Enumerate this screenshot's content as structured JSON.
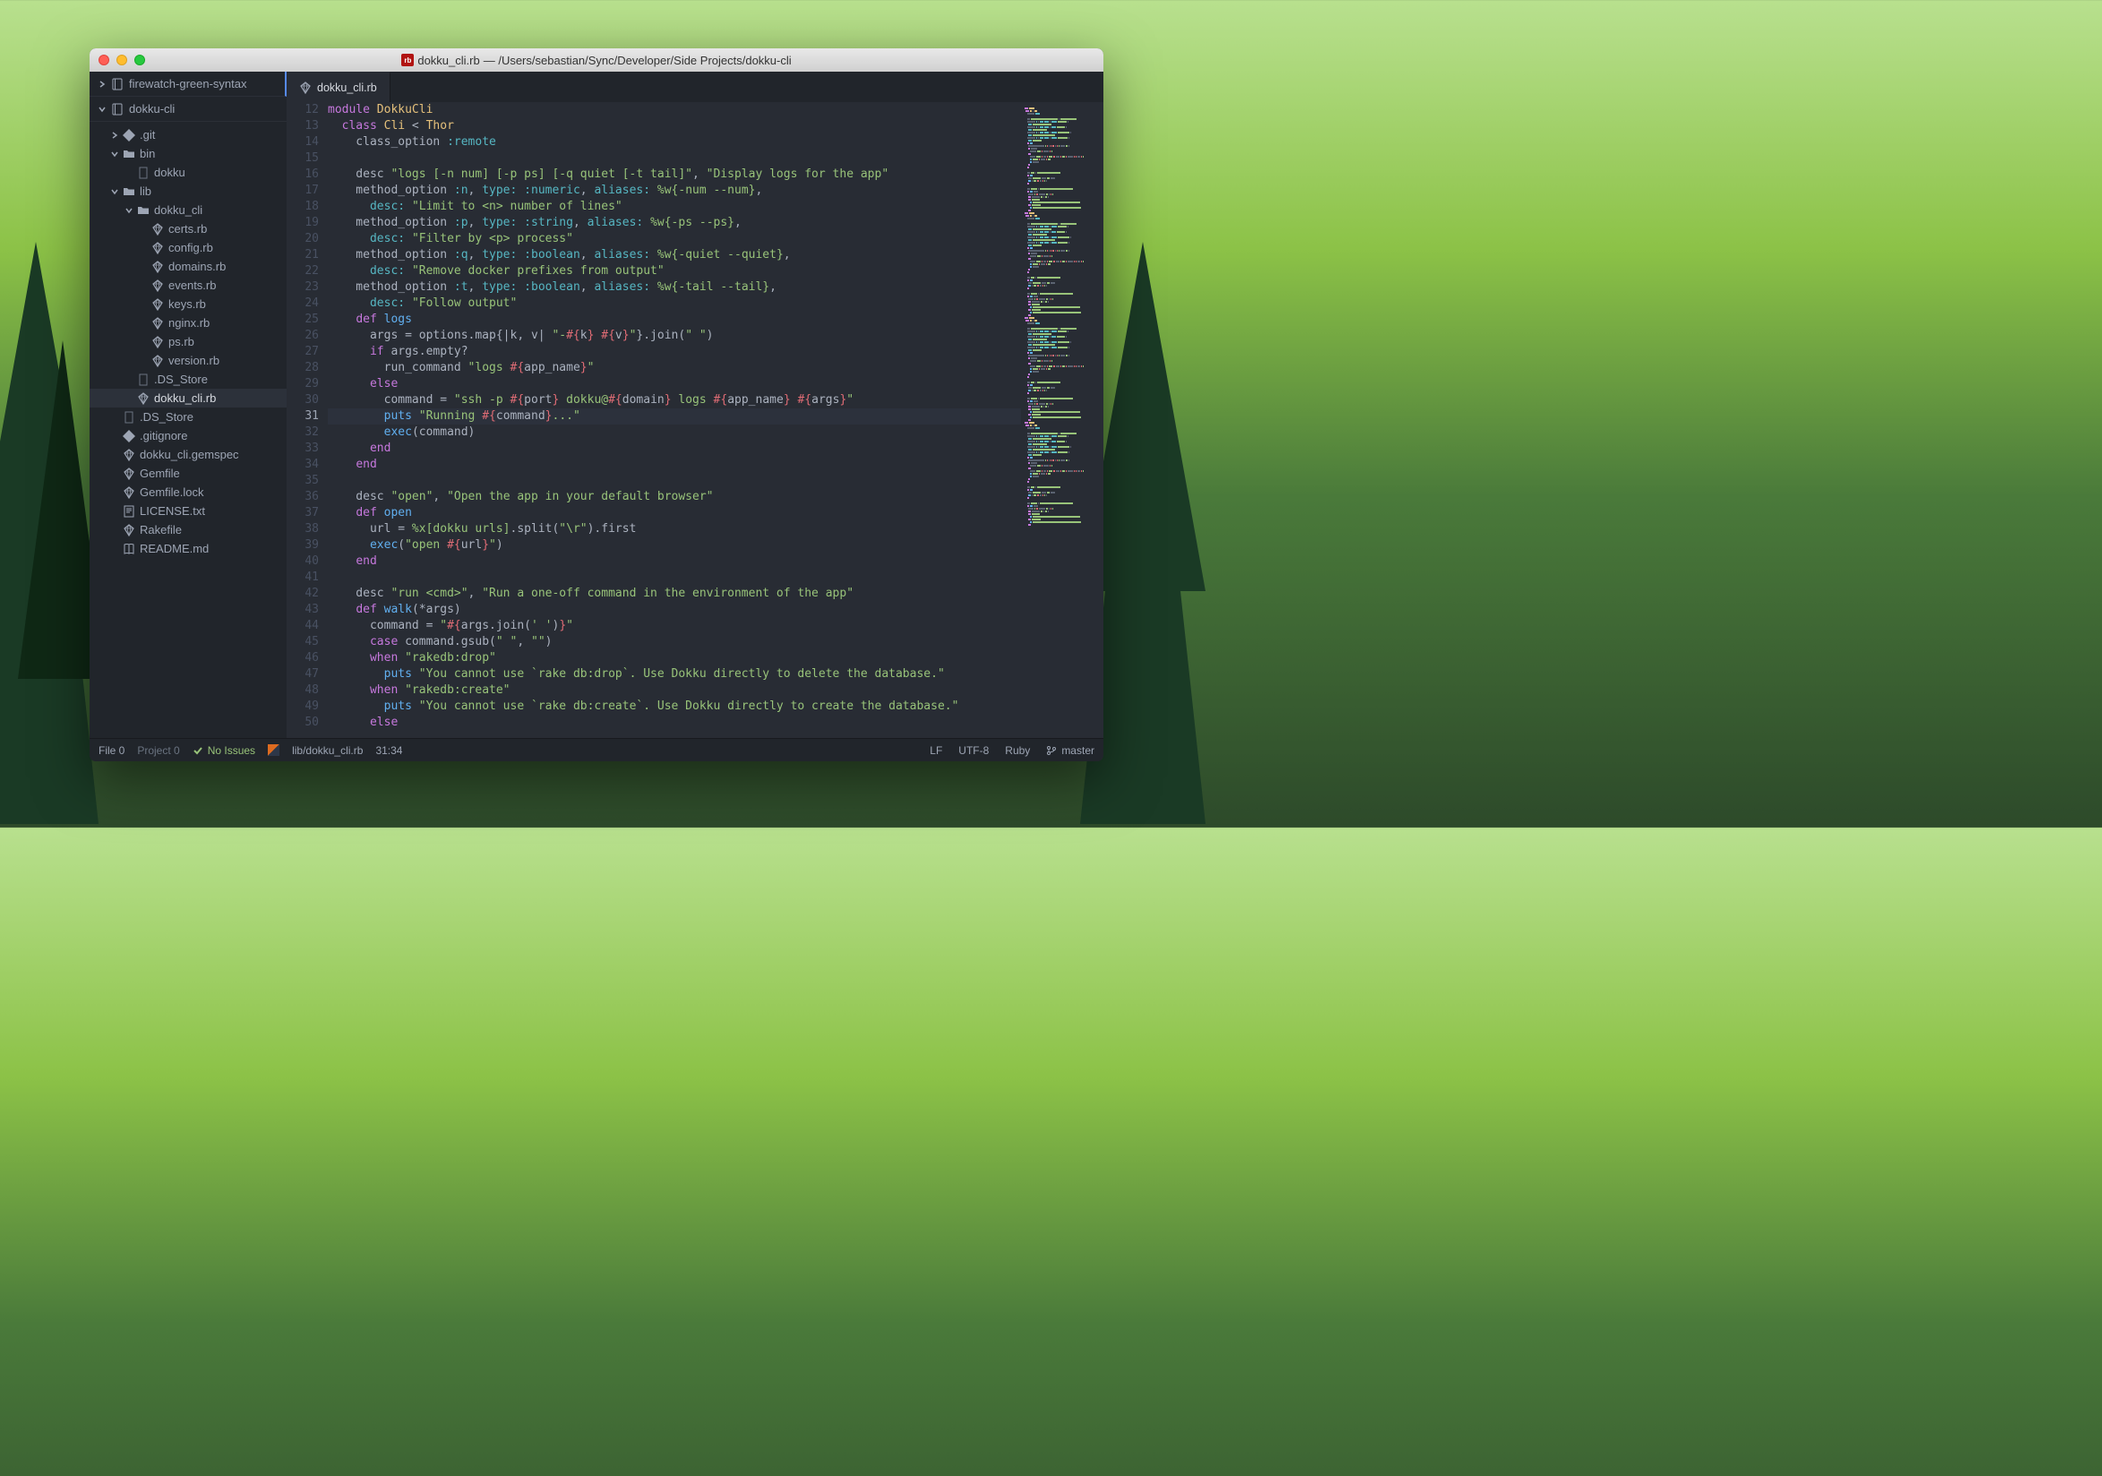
{
  "window": {
    "title_file": "dokku_cli.rb",
    "title_path": "— /Users/sebastian/Sync/Developer/Side Projects/dokku-cli"
  },
  "sidebar": {
    "projects": [
      {
        "name": "firewatch-green-syntax",
        "expanded": false
      },
      {
        "name": "dokku-cli",
        "expanded": true
      }
    ],
    "tree": [
      {
        "level": 1,
        "type": "folder",
        "name": ".git",
        "expanded": false,
        "icon": "git"
      },
      {
        "level": 1,
        "type": "folder",
        "name": "bin",
        "expanded": true,
        "icon": "folder"
      },
      {
        "level": 2,
        "type": "file",
        "name": "dokku",
        "icon": "file"
      },
      {
        "level": 1,
        "type": "folder",
        "name": "lib",
        "expanded": true,
        "icon": "folder"
      },
      {
        "level": 2,
        "type": "folder",
        "name": "dokku_cli",
        "expanded": true,
        "icon": "folder"
      },
      {
        "level": 3,
        "type": "file",
        "name": "certs.rb",
        "icon": "ruby"
      },
      {
        "level": 3,
        "type": "file",
        "name": "config.rb",
        "icon": "ruby"
      },
      {
        "level": 3,
        "type": "file",
        "name": "domains.rb",
        "icon": "ruby"
      },
      {
        "level": 3,
        "type": "file",
        "name": "events.rb",
        "icon": "ruby"
      },
      {
        "level": 3,
        "type": "file",
        "name": "keys.rb",
        "icon": "ruby"
      },
      {
        "level": 3,
        "type": "file",
        "name": "nginx.rb",
        "icon": "ruby"
      },
      {
        "level": 3,
        "type": "file",
        "name": "ps.rb",
        "icon": "ruby"
      },
      {
        "level": 3,
        "type": "file",
        "name": "version.rb",
        "icon": "ruby"
      },
      {
        "level": 2,
        "type": "file",
        "name": ".DS_Store",
        "icon": "file"
      },
      {
        "level": 2,
        "type": "file",
        "name": "dokku_cli.rb",
        "icon": "ruby",
        "selected": true
      },
      {
        "level": 1,
        "type": "file",
        "name": ".DS_Store",
        "icon": "file"
      },
      {
        "level": 1,
        "type": "file",
        "name": ".gitignore",
        "icon": "git"
      },
      {
        "level": 1,
        "type": "file",
        "name": "dokku_cli.gemspec",
        "icon": "ruby"
      },
      {
        "level": 1,
        "type": "file",
        "name": "Gemfile",
        "icon": "ruby"
      },
      {
        "level": 1,
        "type": "file",
        "name": "Gemfile.lock",
        "icon": "ruby"
      },
      {
        "level": 1,
        "type": "file",
        "name": "LICENSE.txt",
        "icon": "text"
      },
      {
        "level": 1,
        "type": "file",
        "name": "Rakefile",
        "icon": "ruby"
      },
      {
        "level": 1,
        "type": "file",
        "name": "README.md",
        "icon": "book"
      }
    ]
  },
  "tabs": [
    {
      "label": "dokku_cli.rb",
      "active": true
    }
  ],
  "editor": {
    "first_line_number": 12,
    "cursor_line": 31,
    "lines": [
      [
        [
          "k",
          "module"
        ],
        [
          "p",
          " "
        ],
        [
          "d",
          "DokkuCli"
        ]
      ],
      [
        [
          "p",
          "  "
        ],
        [
          "k",
          "class"
        ],
        [
          "p",
          " "
        ],
        [
          "d",
          "Cli"
        ],
        [
          "p",
          " < "
        ],
        [
          "d",
          "Thor"
        ]
      ],
      [
        [
          "p",
          "    class_option "
        ],
        [
          "sym",
          ":remote"
        ]
      ],
      [],
      [
        [
          "p",
          "    desc "
        ],
        [
          "s",
          "\"logs [-n num] [-p ps] [-q quiet [-t tail]\""
        ],
        [
          "p",
          ", "
        ],
        [
          "s",
          "\"Display logs for the app\""
        ]
      ],
      [
        [
          "p",
          "    method_option "
        ],
        [
          "sym",
          ":n"
        ],
        [
          "p",
          ", "
        ],
        [
          "sym",
          "type:"
        ],
        [
          "p",
          " "
        ],
        [
          "sym",
          ":numeric"
        ],
        [
          "p",
          ", "
        ],
        [
          "sym",
          "aliases:"
        ],
        [
          "p",
          " "
        ],
        [
          "s",
          "%w{-num --num}"
        ],
        [
          "p",
          ","
        ]
      ],
      [
        [
          "p",
          "      "
        ],
        [
          "sym",
          "desc:"
        ],
        [
          "p",
          " "
        ],
        [
          "s",
          "\"Limit to <n> number of lines\""
        ]
      ],
      [
        [
          "p",
          "    method_option "
        ],
        [
          "sym",
          ":p"
        ],
        [
          "p",
          ", "
        ],
        [
          "sym",
          "type:"
        ],
        [
          "p",
          " "
        ],
        [
          "sym",
          ":string"
        ],
        [
          "p",
          ", "
        ],
        [
          "sym",
          "aliases:"
        ],
        [
          "p",
          " "
        ],
        [
          "s",
          "%w{-ps --ps}"
        ],
        [
          "p",
          ","
        ]
      ],
      [
        [
          "p",
          "      "
        ],
        [
          "sym",
          "desc:"
        ],
        [
          "p",
          " "
        ],
        [
          "s",
          "\"Filter by <p> process\""
        ]
      ],
      [
        [
          "p",
          "    method_option "
        ],
        [
          "sym",
          ":q"
        ],
        [
          "p",
          ", "
        ],
        [
          "sym",
          "type:"
        ],
        [
          "p",
          " "
        ],
        [
          "sym",
          ":boolean"
        ],
        [
          "p",
          ", "
        ],
        [
          "sym",
          "aliases:"
        ],
        [
          "p",
          " "
        ],
        [
          "s",
          "%w{-quiet --quiet}"
        ],
        [
          "p",
          ","
        ]
      ],
      [
        [
          "p",
          "      "
        ],
        [
          "sym",
          "desc:"
        ],
        [
          "p",
          " "
        ],
        [
          "s",
          "\"Remove docker prefixes from output\""
        ]
      ],
      [
        [
          "p",
          "    method_option "
        ],
        [
          "sym",
          ":t"
        ],
        [
          "p",
          ", "
        ],
        [
          "sym",
          "type:"
        ],
        [
          "p",
          " "
        ],
        [
          "sym",
          ":boolean"
        ],
        [
          "p",
          ", "
        ],
        [
          "sym",
          "aliases:"
        ],
        [
          "p",
          " "
        ],
        [
          "s",
          "%w{-tail --tail}"
        ],
        [
          "p",
          ","
        ]
      ],
      [
        [
          "p",
          "      "
        ],
        [
          "sym",
          "desc:"
        ],
        [
          "p",
          " "
        ],
        [
          "s",
          "\"Follow output\""
        ]
      ],
      [
        [
          "p",
          "    "
        ],
        [
          "k",
          "def"
        ],
        [
          "p",
          " "
        ],
        [
          "m",
          "logs"
        ]
      ],
      [
        [
          "p",
          "      args = options.map{|k, v| "
        ],
        [
          "s",
          "\"-"
        ],
        [
          "interp",
          "#{"
        ],
        [
          "p",
          "k"
        ],
        [
          "interp",
          "}"
        ],
        [
          "s",
          " "
        ],
        [
          "interp",
          "#{"
        ],
        [
          "p",
          "v"
        ],
        [
          "interp",
          "}"
        ],
        [
          "s",
          "\""
        ],
        [
          "p",
          "}.join("
        ],
        [
          "s",
          "\" \""
        ],
        [
          "p",
          ")"
        ]
      ],
      [
        [
          "p",
          "      "
        ],
        [
          "k",
          "if"
        ],
        [
          "p",
          " args.empty?"
        ]
      ],
      [
        [
          "p",
          "        run_command "
        ],
        [
          "s",
          "\"logs "
        ],
        [
          "interp",
          "#{"
        ],
        [
          "p",
          "app_name"
        ],
        [
          "interp",
          "}"
        ],
        [
          "s",
          "\""
        ]
      ],
      [
        [
          "p",
          "      "
        ],
        [
          "k",
          "else"
        ]
      ],
      [
        [
          "p",
          "        command = "
        ],
        [
          "s",
          "\"ssh -p "
        ],
        [
          "interp",
          "#{"
        ],
        [
          "p",
          "port"
        ],
        [
          "interp",
          "}"
        ],
        [
          "s",
          " dokku@"
        ],
        [
          "interp",
          "#{"
        ],
        [
          "p",
          "domain"
        ],
        [
          "interp",
          "}"
        ],
        [
          "s",
          " logs "
        ],
        [
          "interp",
          "#{"
        ],
        [
          "p",
          "app_name"
        ],
        [
          "interp",
          "}"
        ],
        [
          "s",
          " "
        ],
        [
          "interp",
          "#{"
        ],
        [
          "p",
          "args"
        ],
        [
          "interp",
          "}"
        ],
        [
          "s",
          "\""
        ]
      ],
      [
        [
          "p",
          "        "
        ],
        [
          "m",
          "puts"
        ],
        [
          "p",
          " "
        ],
        [
          "s",
          "\"Running "
        ],
        [
          "interp",
          "#{"
        ],
        [
          "p",
          "command"
        ],
        [
          "interp",
          "}"
        ],
        [
          "s",
          "...\""
        ]
      ],
      [
        [
          "p",
          "        "
        ],
        [
          "m",
          "exec"
        ],
        [
          "p",
          "(command)"
        ]
      ],
      [
        [
          "p",
          "      "
        ],
        [
          "k",
          "end"
        ]
      ],
      [
        [
          "p",
          "    "
        ],
        [
          "k",
          "end"
        ]
      ],
      [],
      [
        [
          "p",
          "    desc "
        ],
        [
          "s",
          "\"open\""
        ],
        [
          "p",
          ", "
        ],
        [
          "s",
          "\"Open the app in your default browser\""
        ]
      ],
      [
        [
          "p",
          "    "
        ],
        [
          "k",
          "def"
        ],
        [
          "p",
          " "
        ],
        [
          "m",
          "open"
        ]
      ],
      [
        [
          "p",
          "      url = "
        ],
        [
          "s",
          "%x[dokku urls]"
        ],
        [
          "p",
          ".split("
        ],
        [
          "s",
          "\"\\r\""
        ],
        [
          "p",
          ").first"
        ]
      ],
      [
        [
          "p",
          "      "
        ],
        [
          "m",
          "exec"
        ],
        [
          "p",
          "("
        ],
        [
          "s",
          "\"open "
        ],
        [
          "interp",
          "#{"
        ],
        [
          "p",
          "url"
        ],
        [
          "interp",
          "}"
        ],
        [
          "s",
          "\""
        ],
        [
          "p",
          ")"
        ]
      ],
      [
        [
          "p",
          "    "
        ],
        [
          "k",
          "end"
        ]
      ],
      [],
      [
        [
          "p",
          "    desc "
        ],
        [
          "s",
          "\"run <cmd>\""
        ],
        [
          "p",
          ", "
        ],
        [
          "s",
          "\"Run a one-off command in the environment of the app\""
        ]
      ],
      [
        [
          "p",
          "    "
        ],
        [
          "k",
          "def"
        ],
        [
          "p",
          " "
        ],
        [
          "m",
          "walk"
        ],
        [
          "p",
          "(*args)"
        ]
      ],
      [
        [
          "p",
          "      command = "
        ],
        [
          "s",
          "\""
        ],
        [
          "interp",
          "#{"
        ],
        [
          "p",
          "args.join("
        ],
        [
          "s",
          "' '"
        ],
        [
          "p",
          ")"
        ],
        [
          "interp",
          "}"
        ],
        [
          "s",
          "\""
        ]
      ],
      [
        [
          "p",
          "      "
        ],
        [
          "k",
          "case"
        ],
        [
          "p",
          " command.gsub("
        ],
        [
          "s",
          "\" \""
        ],
        [
          "p",
          ", "
        ],
        [
          "s",
          "\"\""
        ],
        [
          "p",
          ")"
        ]
      ],
      [
        [
          "p",
          "      "
        ],
        [
          "k",
          "when"
        ],
        [
          "p",
          " "
        ],
        [
          "s",
          "\"rakedb:drop\""
        ]
      ],
      [
        [
          "p",
          "        "
        ],
        [
          "m",
          "puts"
        ],
        [
          "p",
          " "
        ],
        [
          "s",
          "\"You cannot use `rake db:drop`. Use Dokku directly to delete the database.\""
        ]
      ],
      [
        [
          "p",
          "      "
        ],
        [
          "k",
          "when"
        ],
        [
          "p",
          " "
        ],
        [
          "s",
          "\"rakedb:create\""
        ]
      ],
      [
        [
          "p",
          "        "
        ],
        [
          "m",
          "puts"
        ],
        [
          "p",
          " "
        ],
        [
          "s",
          "\"You cannot use `rake db:create`. Use Dokku directly to create the database.\""
        ]
      ],
      [
        [
          "p",
          "      "
        ],
        [
          "k",
          "else"
        ]
      ]
    ]
  },
  "statusbar": {
    "file_count": "File 0",
    "project_count": "Project 0",
    "issues": "No Issues",
    "filepath": "lib/dokku_cli.rb",
    "cursor_pos": "31:34",
    "line_ending": "LF",
    "encoding": "UTF-8",
    "language": "Ruby",
    "branch": "master"
  }
}
